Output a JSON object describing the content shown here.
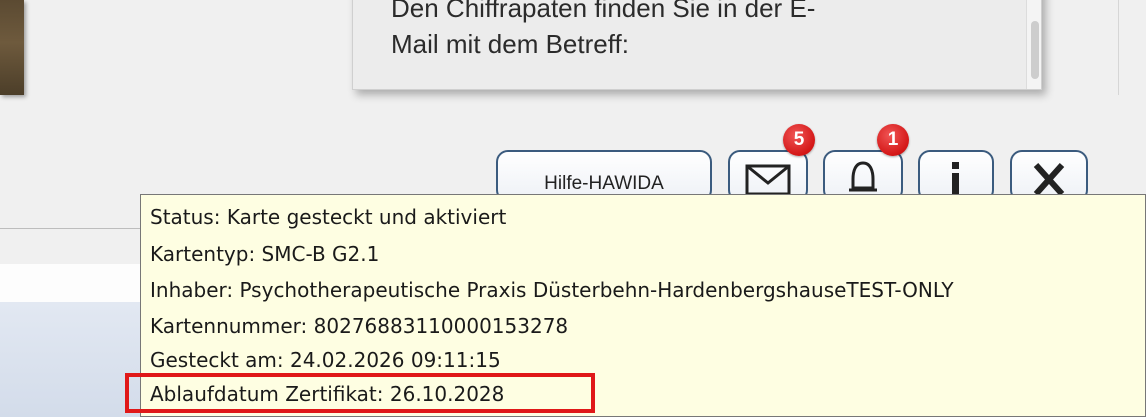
{
  "message": {
    "line_1": "Den Chiffrapaten finden Sie in der E-",
    "line_2": "Mail mit dem Betreff:"
  },
  "toolbar": {
    "help_label": "Hilfe-HAWIDA",
    "mail_badge": "5",
    "bell_badge": "1",
    "icons": [
      "mail-icon",
      "bell-icon",
      "info-icon",
      "close-icon"
    ]
  },
  "tooltip": {
    "lines": [
      "Status: Karte gesteckt und aktiviert",
      "Kartentyp: SMC-B G2.1",
      "Inhaber: Psychotherapeutische Praxis Düsterbehn-HardenbergshauseTEST-ONLY",
      "Kartennummer: 80276883110000153278",
      "Gesteckt am: 24.02.2026 09:11:15",
      "Ablaufdatum Zertifikat: 26.10.2028"
    ]
  },
  "colors": {
    "accent_border": "#3b5b7e",
    "badge": "#d41717",
    "tooltip_bg": "#fefee2",
    "highlight": "#e01818"
  }
}
